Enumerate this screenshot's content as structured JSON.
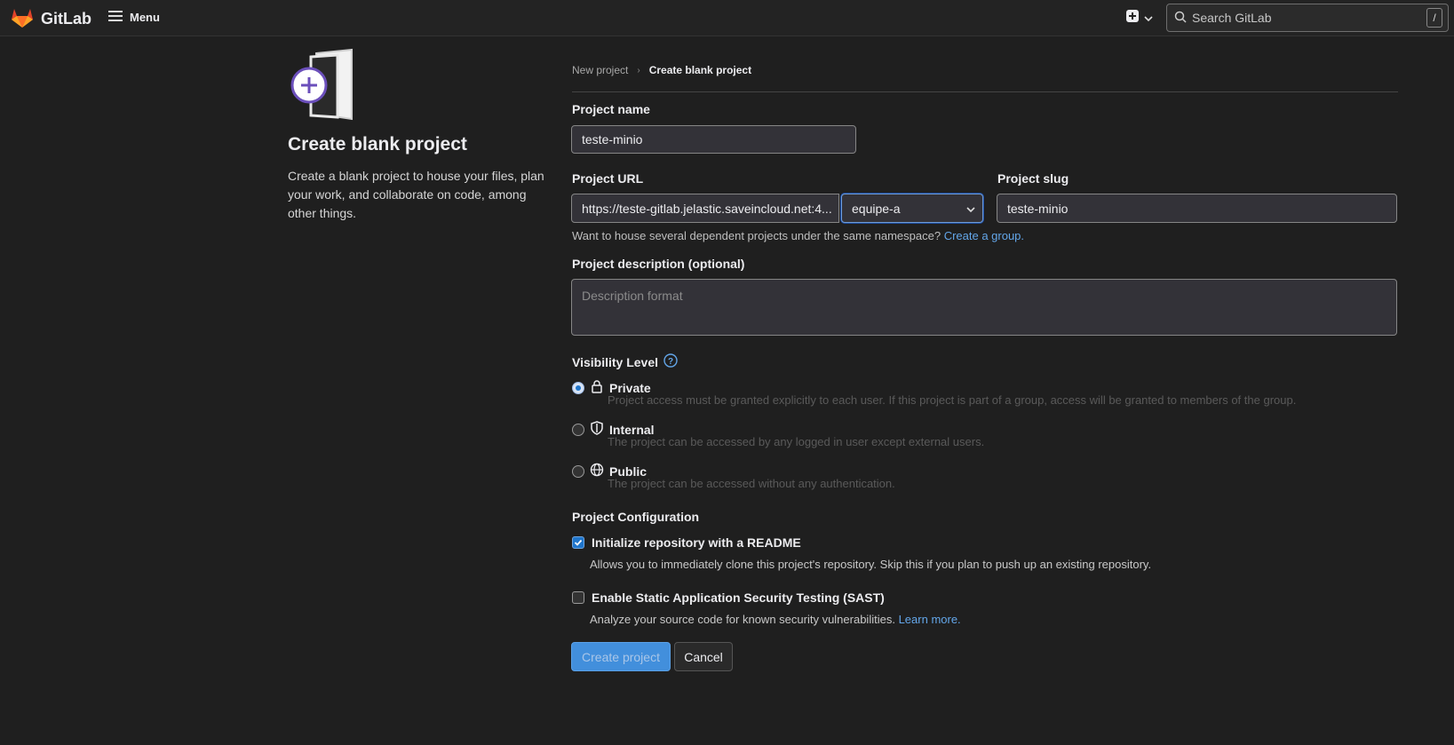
{
  "topbar": {
    "brand": "GitLab",
    "menu_label": "Menu",
    "search_placeholder": "Search GitLab",
    "search_shortcut": "/"
  },
  "left": {
    "title": "Create blank project",
    "description": "Create a blank project to house your files, plan your work, and collaborate on code, among other things."
  },
  "breadcrumb": {
    "items": [
      "New project",
      "Create blank project"
    ]
  },
  "form": {
    "project_name_label": "Project name",
    "project_name_value": "teste-minio",
    "project_url_label": "Project URL",
    "project_url_prefix": "https://teste-gitlab.jelastic.saveincloud.net:4...",
    "namespace_value": "equipe-a",
    "project_slug_label": "Project slug",
    "project_slug_value": "teste-minio",
    "namespace_hint": "Want to house several dependent projects under the same namespace?",
    "namespace_hint_link": "Create a group.",
    "description_label": "Project description (optional)",
    "description_placeholder": "Description format",
    "visibility_label": "Visibility Level",
    "visibility_options": [
      {
        "label": "Private",
        "desc": "Project access must be granted explicitly to each user. If this project is part of a group, access will be granted to members of the group.",
        "selected": true
      },
      {
        "label": "Internal",
        "desc": "The project can be accessed by any logged in user except external users.",
        "selected": false
      },
      {
        "label": "Public",
        "desc": "The project can be accessed without any authentication.",
        "selected": false
      }
    ],
    "config_label": "Project Configuration",
    "readme_label": "Initialize repository with a README",
    "readme_desc": "Allows you to immediately clone this project's repository. Skip this if you plan to push up an existing repository.",
    "readme_checked": true,
    "sast_label": "Enable Static Application Security Testing (SAST)",
    "sast_desc": "Analyze your source code for known security vulnerabilities.",
    "sast_link": "Learn more.",
    "sast_checked": false,
    "create_button": "Create project",
    "cancel_button": "Cancel"
  },
  "colors": {
    "background": "#1f1f1f",
    "accent": "#428fdc",
    "link": "#63a6e9",
    "gitlab_orange": "#e24329",
    "illustration_purple": "#6b4fbb"
  }
}
